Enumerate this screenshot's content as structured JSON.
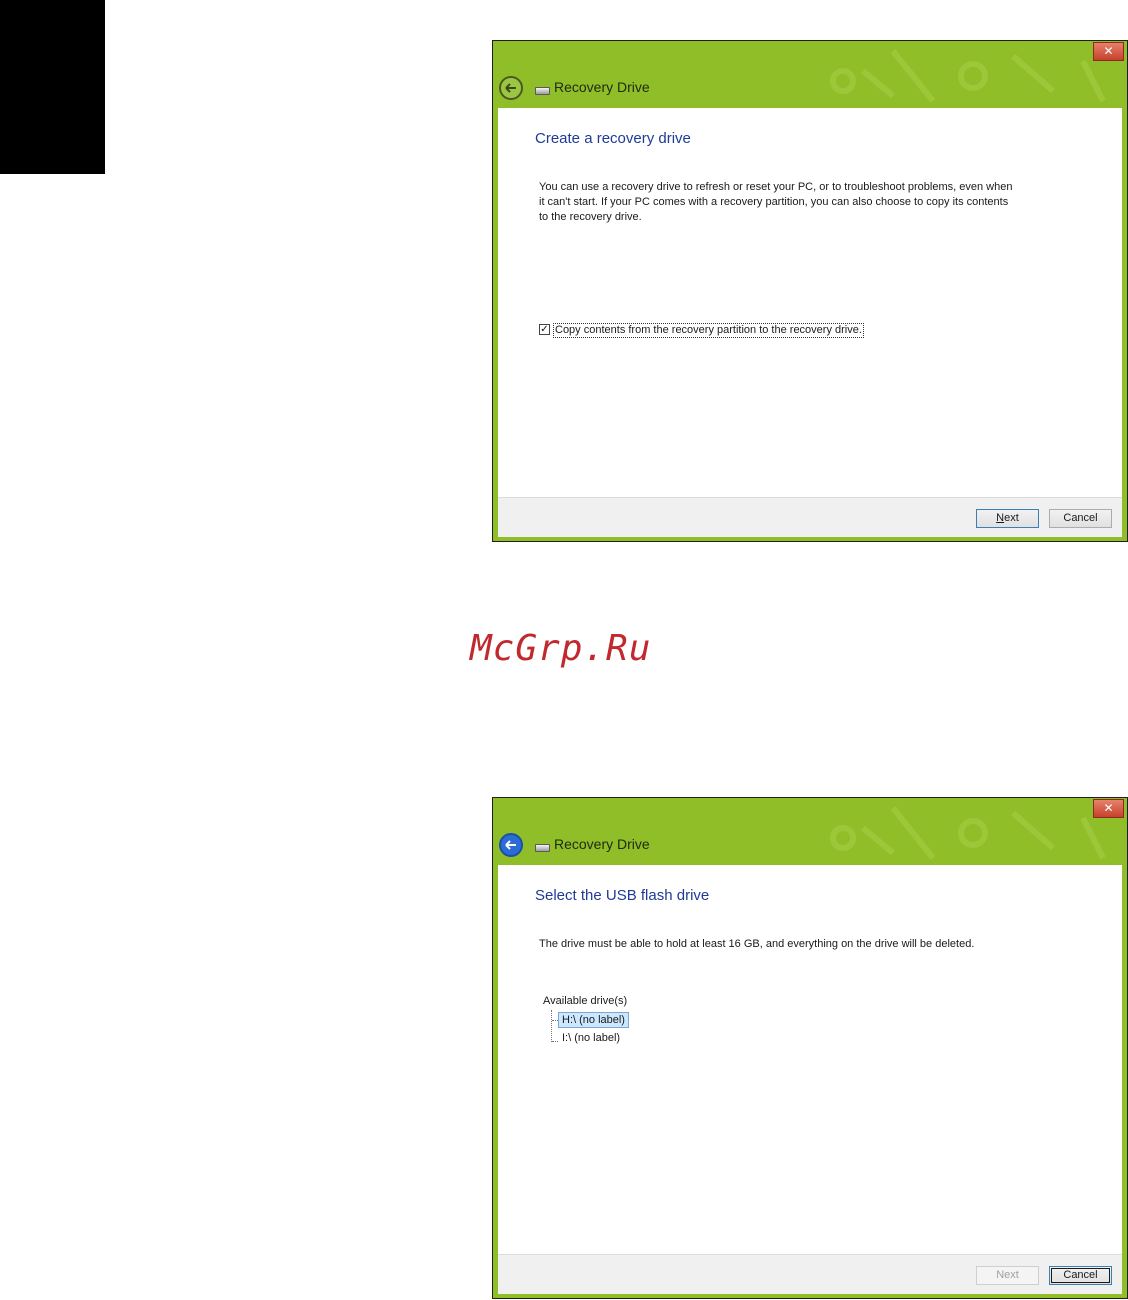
{
  "window1": {
    "title": "Recovery Drive",
    "close_glyph": "✕",
    "heading": "Create a recovery drive",
    "body_line1": "You can use a recovery drive to refresh or reset your PC, or to troubleshoot problems, even when",
    "body_line2": "it can't start. If your PC comes with a recovery partition, you can also choose to copy its contents",
    "body_line3": "to the recovery drive.",
    "checkbox_label": "Copy contents from the recovery partition to the recovery drive.",
    "checkbox_checked": true,
    "checkbox_mark": "✓",
    "next_label": "Next",
    "next_access_key": "N",
    "next_rest": "ext",
    "cancel_label": "Cancel"
  },
  "watermark": "McGrp.Ru",
  "window2": {
    "title": "Recovery Drive",
    "close_glyph": "✕",
    "heading": "Select the USB flash drive",
    "body_line1": "The drive must be able to hold at least 16 GB, and everything on the drive will be deleted.",
    "tree_label": "Available drive(s)",
    "drives": [
      "H:\\ (no label)",
      "I:\\ (no label)"
    ],
    "selected_drive": "H:\\ (no label)",
    "next_label": "Next",
    "next_enabled": false,
    "cancel_label": "Cancel"
  },
  "colors": {
    "titlebar": "#8fbe29",
    "heading": "#1f3b95",
    "close_button": "#c7412c",
    "watermark": "#c0292e"
  },
  "icons": {
    "close": "close-icon",
    "back": "back-arrow-icon",
    "drive": "drive-icon"
  }
}
